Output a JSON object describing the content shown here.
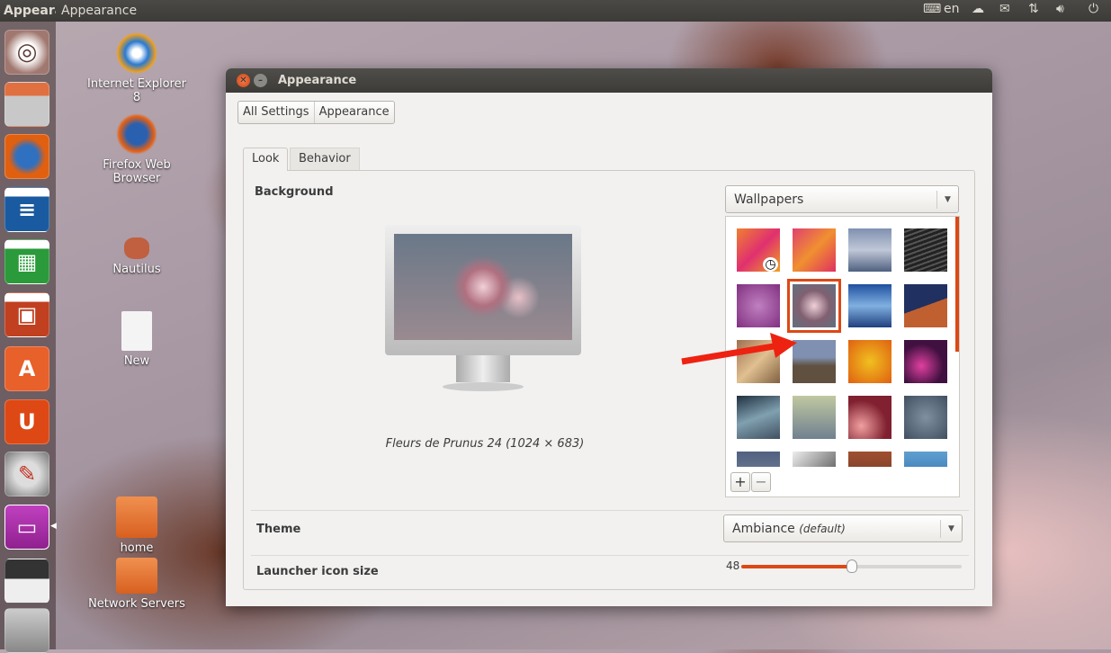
{
  "panel": {
    "app_name": "Appearance",
    "menu_title": "Appearance",
    "language": "en",
    "indicators": [
      "keyboard-icon",
      "cloud-icon",
      "mail-icon",
      "network-icon",
      "volume-icon",
      "power-icon"
    ]
  },
  "launcher": {
    "items": [
      "Dash Home",
      "Files",
      "Firefox Web Browser",
      "LibreOffice Writer",
      "LibreOffice Calc",
      "LibreOffice Impress",
      "Ubuntu Software Center",
      "Ubuntu One",
      "System Settings",
      "Appearance",
      "Floppy",
      "Trash"
    ],
    "active": "Appearance"
  },
  "desktop": {
    "icons": [
      {
        "label": "Internet Explorer 8"
      },
      {
        "label": "Firefox Web Browser"
      },
      {
        "label": "Nautilus"
      },
      {
        "label": "New"
      },
      {
        "label": "home"
      },
      {
        "label": "Network Servers"
      }
    ]
  },
  "window": {
    "title": "Appearance",
    "breadcrumb": [
      "All Settings",
      "Appearance"
    ],
    "tabs": [
      "Look",
      "Behavior"
    ],
    "active_tab": "Look",
    "background": {
      "label": "Background",
      "source": "Wallpapers",
      "caption": "Fleurs de Prunus 24 (1024 × 683)",
      "add": "+",
      "remove": "−",
      "selected_index": 5
    },
    "theme": {
      "label": "Theme",
      "value": "Ambiance",
      "note": "(default)"
    },
    "icon_size": {
      "label": "Launcher icon size",
      "value": "48",
      "min": 32,
      "max": 64
    }
  },
  "colors": {
    "accent": "#dd4814",
    "panel": "#3c3b37"
  }
}
